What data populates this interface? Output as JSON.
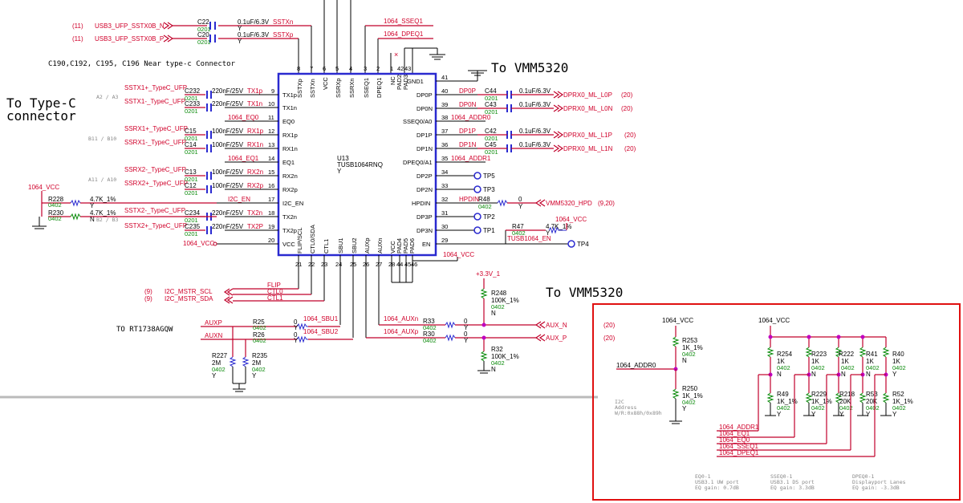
{
  "headings": {
    "to_typec_1": "To Type-C",
    "to_typec_2": "connector",
    "to_vmm_top": "To VMM5320",
    "to_vmm_mid": "To VMM5320",
    "to_rt": "TO RT1738AGQW",
    "near_note": "C190,C192, C195, C196 Near type-c  Connector"
  },
  "refs": {
    "r11": "(11)",
    "r20": "(20)",
    "r9": "(9)",
    "r920": "(9,20)"
  },
  "top_nets": {
    "n": "USB3_UFP_SSTX0B_N",
    "p": "USB3_UFP_SSTX0B_P",
    "sstxn": "SSTXn",
    "sstxp": "SSTXp",
    "sseq1": "1064_SSEQ1",
    "dpeq1": "1064_DPEQ1"
  },
  "caps": {
    "c22": "C22",
    "c20": "C20"
  },
  "pkg": {
    "p0201": "0201",
    "p0402": "0402"
  },
  "vals": {
    "c01u": "0.1uF/6.3V",
    "c220n": "220nF/25V",
    "c100n": "100nF/25V",
    "y": "Y",
    "n": "N",
    "zero": "0",
    "r47k": "4.7K_1%",
    "r2m": "2M",
    "r100k": "100K_1%",
    "r1k1": "1K_1%",
    "r1k": "1K",
    "r20k": "20K"
  },
  "ic": {
    "ref": "U13",
    "part": "TUSB1064RNQ",
    "top": [
      "SSTXp",
      "SSTXn",
      "VCC",
      "SSRXp",
      "SSRXn",
      "SSEQ1",
      "DPEQ1",
      "NC",
      "PAD2",
      "PAD3"
    ],
    "topn": [
      "8",
      "7",
      "6",
      "5",
      "4",
      "3",
      "2",
      "1",
      "42",
      "43"
    ],
    "left": [
      "TX1p",
      "TX1n",
      "EQ0",
      "RX1p",
      "RX1n",
      "EQ1",
      "RX2n",
      "RX2p",
      "I2C_EN",
      "TX2n",
      "TX2p",
      "VCC"
    ],
    "leftn": [
      "9",
      "10",
      "11",
      "12",
      "13",
      "14",
      "15",
      "16",
      "17",
      "18",
      "19",
      "20"
    ],
    "right": [
      "GND1",
      "DP0P",
      "DP0N",
      "SSEQ0/A0",
      "DP1P",
      "DP1N",
      "DPEQ0/A1",
      "DP2P",
      "DP2N",
      "HPDIN",
      "DP3P",
      "DP3N",
      "EN"
    ],
    "rightn": [
      "41",
      "40",
      "39",
      "38",
      "37",
      "36",
      "35",
      "34",
      "33",
      "32",
      "31",
      "30",
      "29"
    ],
    "bot": [
      "FLIP/SCL",
      "CTL0/SDA",
      "CTL1",
      "SBU1",
      "SBU2",
      "AUXp",
      "AUXn",
      "VCC",
      "PAD4",
      "PAD5",
      "PAD6"
    ],
    "botn": [
      "21",
      "22",
      "23",
      "24",
      "25",
      "26",
      "27",
      "28",
      "44",
      "45",
      "46"
    ]
  },
  "left_nets": [
    "SSTX1+_TypeC_UFP",
    "SSTX1-_TypeC_UFP",
    "SSRX1+_TypeC_UFP",
    "SSRX1-_TypeC_UFP",
    "SSRX2-_TypeC_UFP",
    "SSRX2+_TypeC_UFP",
    "SSTX2-_TypeC_UFP",
    "SSTX2+_TypeC_UFP"
  ],
  "left_caps": [
    "C232",
    "C233",
    "C15",
    "C14",
    "C13",
    "C12",
    "C234",
    "C235"
  ],
  "left_pins": {
    "0": "TX1p",
    "1": "TX1n",
    "2": "RX1p",
    "3": "RX1n",
    "4": "RX2n",
    "5": "RX2p",
    "6": "TX2n",
    "7": "TX2P",
    "eq0": "1064_EQ0",
    "eq1": "1064_EQ1",
    "i2cen": "I2C_EN",
    "vcc": "1064_VCC"
  },
  "left_tags": {
    "a": "A2 / A3",
    "b": "B11 / B10",
    "c": "A11 / A10",
    "d": "B2 / B3"
  },
  "misc": {
    "vcc1064": "1064_VCC",
    "v33": "+3.3V_1"
  },
  "res": {
    "r228": "R228",
    "r230": "R230",
    "r48": "R48",
    "r47": "R47",
    "r25": "R25",
    "r26": "R26",
    "r227": "R227",
    "r235": "R235",
    "r33": "R33",
    "r30": "R30",
    "r248": "R248",
    "r32": "R32",
    "r253": "R253",
    "r250": "R250",
    "r254": "R254",
    "r223": "R223",
    "r222": "R222",
    "r41": "R41",
    "r40": "R40",
    "r49": "R49",
    "r229": "R229",
    "r218": "R218",
    "r53": "R53",
    "r52": "R52"
  },
  "right_nets": {
    "dp0p": "DP0P",
    "dp0n": "DP0N",
    "dp1p": "DP1P",
    "dp1n": "DP1N",
    "addr0": "1064_ADDR0",
    "addr1": "1064_ADDR1",
    "l0p": "DPRX0_ML_L0P",
    "l0n": "DPRX0_ML_L0N",
    "l1p": "DPRX0_ML_L1P",
    "l1n": "DPRX0_ML_L1N",
    "hpd": "HPDIN",
    "vmm_hpd": "VMM5320_HPD",
    "en": "TUSB1064_EN"
  },
  "right_caps": [
    "C44",
    "C43",
    "C42",
    "C45"
  ],
  "tps": {
    "tp5": "TP5",
    "tp3": "TP3",
    "tp2": "TP2",
    "tp1": "TP1",
    "tp4": "TP4"
  },
  "bot_nets": {
    "flip": "FLIP",
    "ctl0": "CTL0",
    "ctl1": "CTL1",
    "i2c_scl": "I2C_MSTR_SCL",
    "i2c_sda": "I2C_MSTR_SDA",
    "auxp": "AUXP",
    "auxn": "AUXN",
    "sbu1": "1064_SBU1",
    "sbu2": "1064_SBU2",
    "auxn_1064": "1064_AUXn",
    "auxp_1064": "1064_AUXp",
    "aux_n": "AUX_N",
    "aux_p": "AUX_P"
  },
  "box": {
    "addr0": "1064_ADDR0",
    "i2c_addr_1": "I2C",
    "i2c_addr_2": "Address",
    "i2c_addr_3": "W/R:0x88h/0x89h",
    "bus": [
      "1064_ADDR1",
      "1064_EQ1",
      "1064_EQ0",
      "1064_SSEQ1",
      "1064_DPEQ1"
    ],
    "note1": [
      "EQ0-1",
      "USB3.1 UW port",
      "EQ gain: 0.7dB"
    ],
    "note2": [
      "SSEQ0-1",
      "USB3.1 DS port",
      "EQ gain: 3.3dB"
    ],
    "note3": [
      "DPEQ0-1",
      "Displayport Lanes",
      "EQ gain: -3.3dB"
    ]
  }
}
